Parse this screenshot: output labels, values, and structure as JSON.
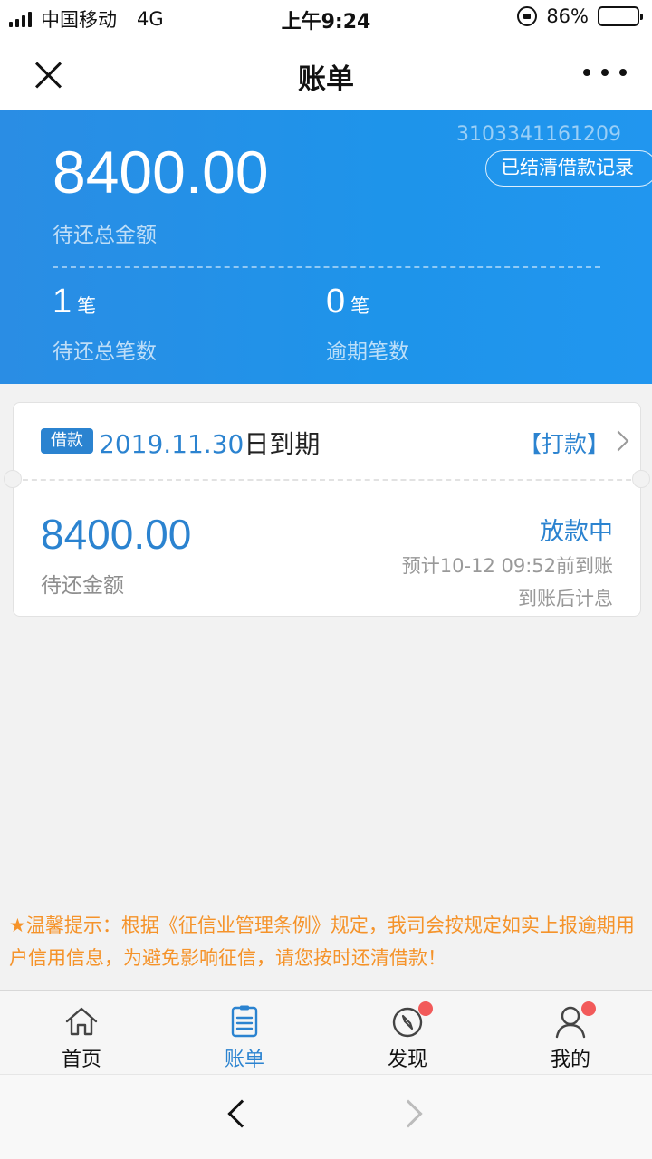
{
  "status_bar": {
    "carrier": "中国移动",
    "network": "4G",
    "time": "上午9:24",
    "battery_text": "86%",
    "battery_level": 0.86
  },
  "nav": {
    "title": "账单"
  },
  "summary": {
    "loan_id": "3103341161209",
    "records_button": "已结清借款记录",
    "total_amount": "8400.00",
    "total_label": "待还总金额",
    "pending_count": "1",
    "pending_unit": "笔",
    "pending_label": "待还总笔数",
    "overdue_count": "0",
    "overdue_unit": "笔",
    "overdue_label": "逾期笔数"
  },
  "bill_card": {
    "tag": "借款",
    "due_date": "2019.11.30",
    "due_suffix": "日到期",
    "pay_link": "【打款】",
    "amount": "8400.00",
    "amount_label": "待还金额",
    "status": "放款中",
    "eta": "预计10-12 09:52前到账",
    "interest_note": "到账后计息"
  },
  "tip": {
    "text": "★温馨提示：根据《征信业管理条例》规定，我司会按规定如实上报逾期用户信用信息，为避免影响征信，请您按时还清借款！"
  },
  "tabs": [
    {
      "label": "首页",
      "icon": "home-icon",
      "active": false
    },
    {
      "label": "账单",
      "icon": "bill-icon",
      "active": true
    },
    {
      "label": "发现",
      "icon": "compass-icon",
      "active": false
    },
    {
      "label": "我的",
      "icon": "user-icon",
      "active": false
    }
  ],
  "colors": {
    "accent": "#2b83d0",
    "hero_blue": "#1e94ea",
    "warning": "#f5932a",
    "badge": "#f25a5a"
  }
}
